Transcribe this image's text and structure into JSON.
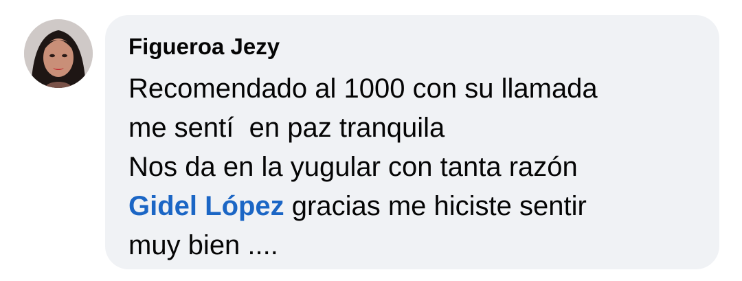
{
  "comment": {
    "author": "Figueroa Jezy",
    "avatar_icon": "profile-photo-avatar",
    "lines": [
      "Recomendado al 1000 con su llamada",
      "me sentí  en paz tranquila",
      "Nos da en la yugular con tanta razón"
    ],
    "mention": {
      "name": "Gidel López",
      "rest": " gracias me hiciste sentir"
    },
    "last_line": "muy bien ....",
    "colors": {
      "bubble_bg": "#f0f2f5",
      "text": "#050505",
      "mention": "#1b66c5"
    }
  }
}
